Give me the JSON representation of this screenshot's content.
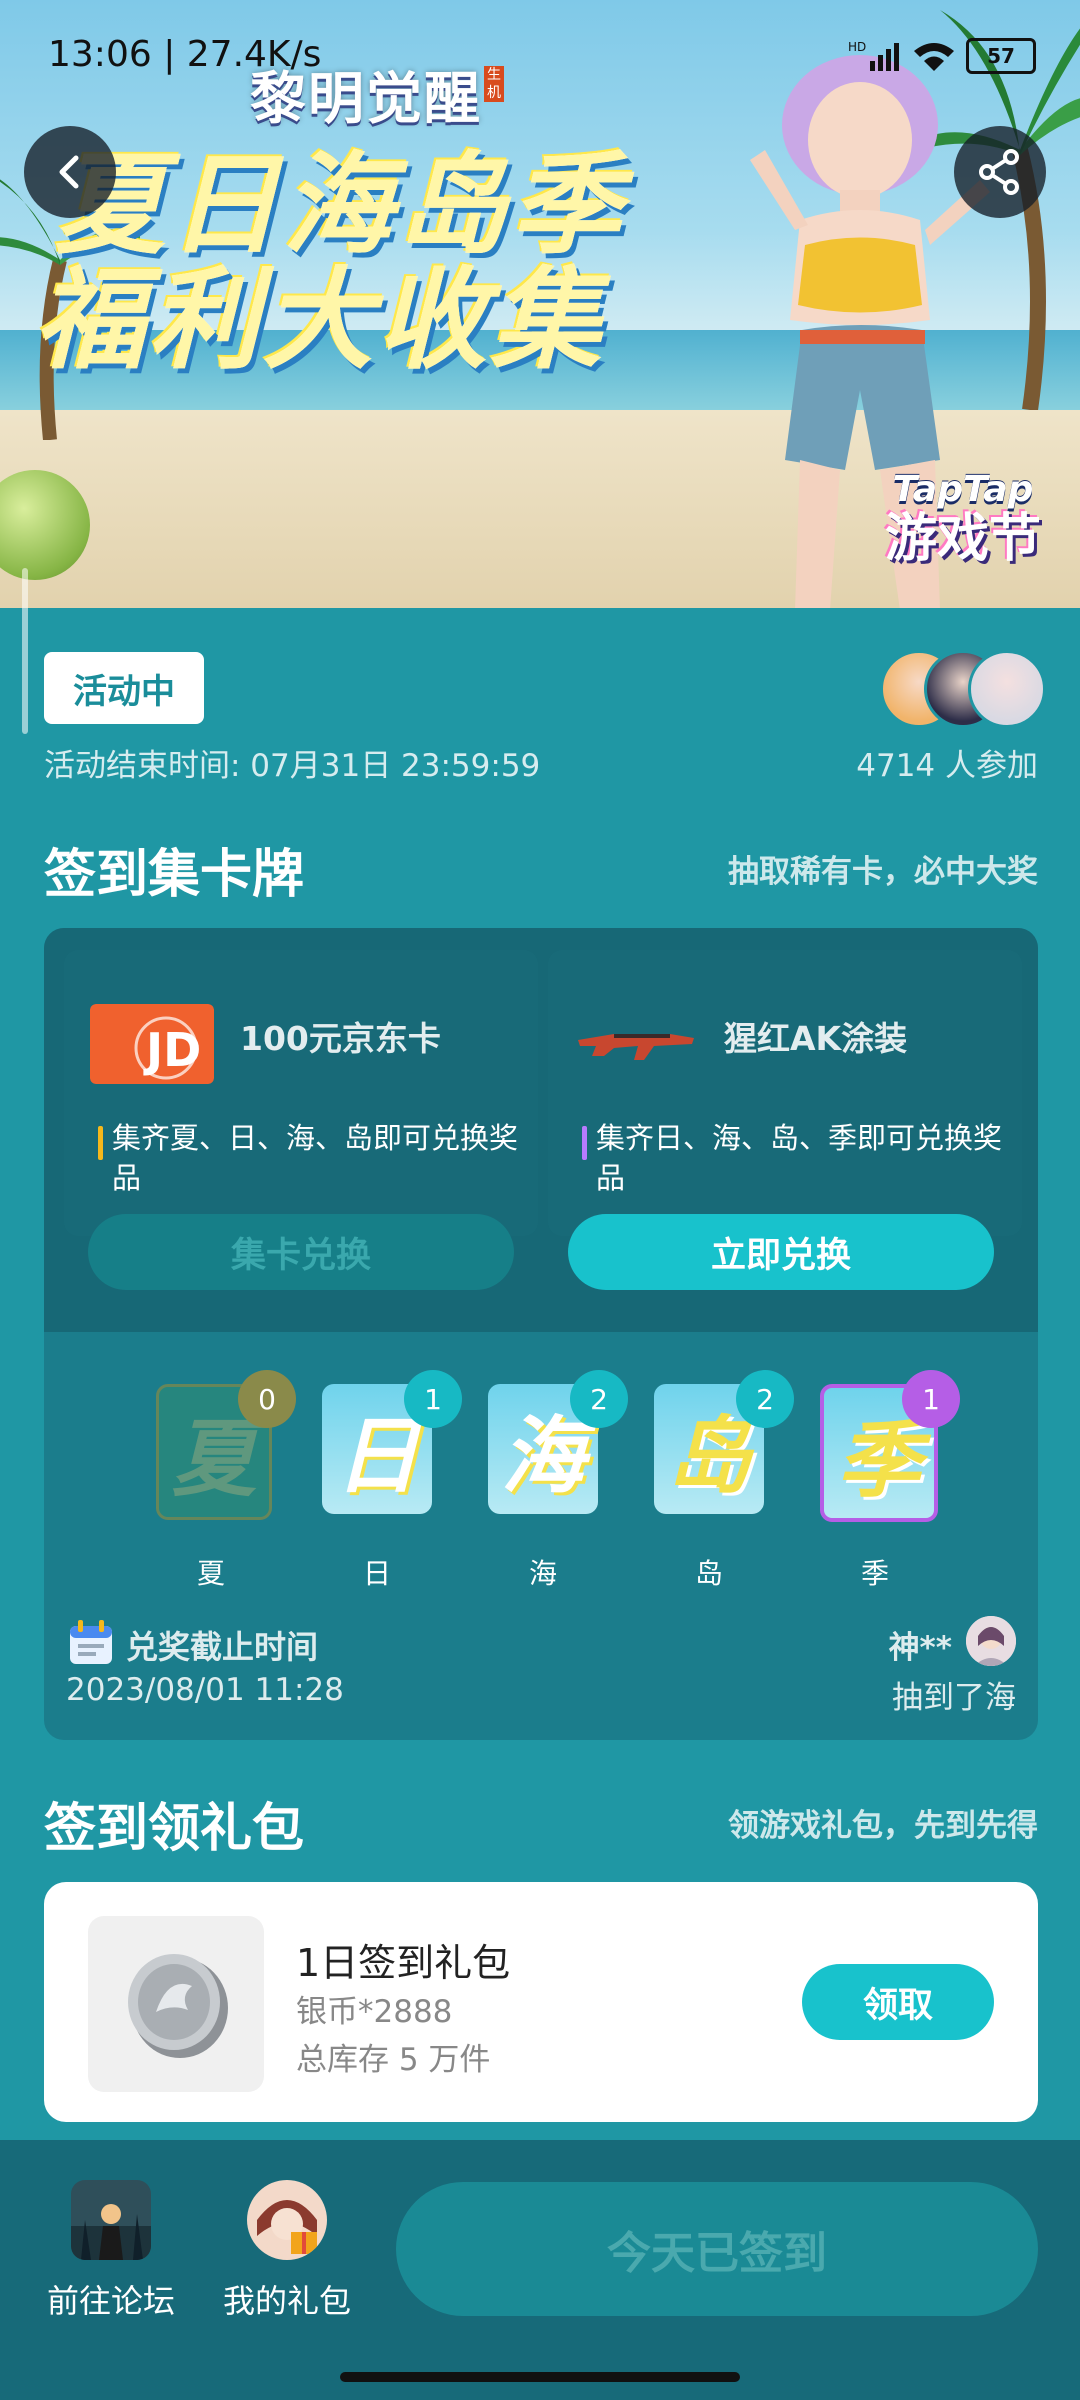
{
  "status_bar": {
    "time": "13:06 | 27.4K/s",
    "battery": "57"
  },
  "banner": {
    "game_logo": "黎明觉醒",
    "logo_tag": "生机",
    "headline_line1": "夏日海岛季",
    "headline_line2": "福利大收集",
    "festival_brand": "TapTap",
    "festival_name": "游戏节"
  },
  "activity": {
    "status_badge": "活动中",
    "end_time": "活动结束时间: 07月31日 23:59:59",
    "participants": "4714 人参加"
  },
  "card_section": {
    "title": "签到集卡牌",
    "subtitle": "抽取稀有卡，必中大奖",
    "prizes": [
      {
        "name": "100元京东卡",
        "description": "集齐夏、日、海、岛即可兑换奖品",
        "button": "集卡兑换",
        "enabled": false
      },
      {
        "name": "猩红AK涂装",
        "description": "集齐日、海、岛、季即可兑换奖品",
        "button": "立即兑换",
        "enabled": true
      }
    ],
    "letters": [
      {
        "char": "夏",
        "label": "夏",
        "count": "0"
      },
      {
        "char": "日",
        "label": "日",
        "count": "1"
      },
      {
        "char": "海",
        "label": "海",
        "count": "2"
      },
      {
        "char": "岛",
        "label": "岛",
        "count": "2"
      },
      {
        "char": "季",
        "label": "季",
        "count": "1"
      }
    ],
    "deadline_label": "兑奖截止时间",
    "deadline_value": "2023/08/01 11:28",
    "recent_drawer": "神**",
    "recent_draw_text": "抽到了海"
  },
  "gift_section": {
    "title": "签到领礼包",
    "subtitle": "领游戏礼包，先到先得",
    "gift": {
      "title": "1日签到礼包",
      "content": "银币*2888",
      "stock": "总库存 5 万件",
      "button": "领取"
    }
  },
  "bottom_bar": {
    "forum_label": "前往论坛",
    "gifts_label": "我的礼包",
    "signed_button": "今天已签到"
  },
  "colors": {
    "background": "#1f97a4",
    "accent": "#18c2cc",
    "panel": "#1b7d8c"
  }
}
